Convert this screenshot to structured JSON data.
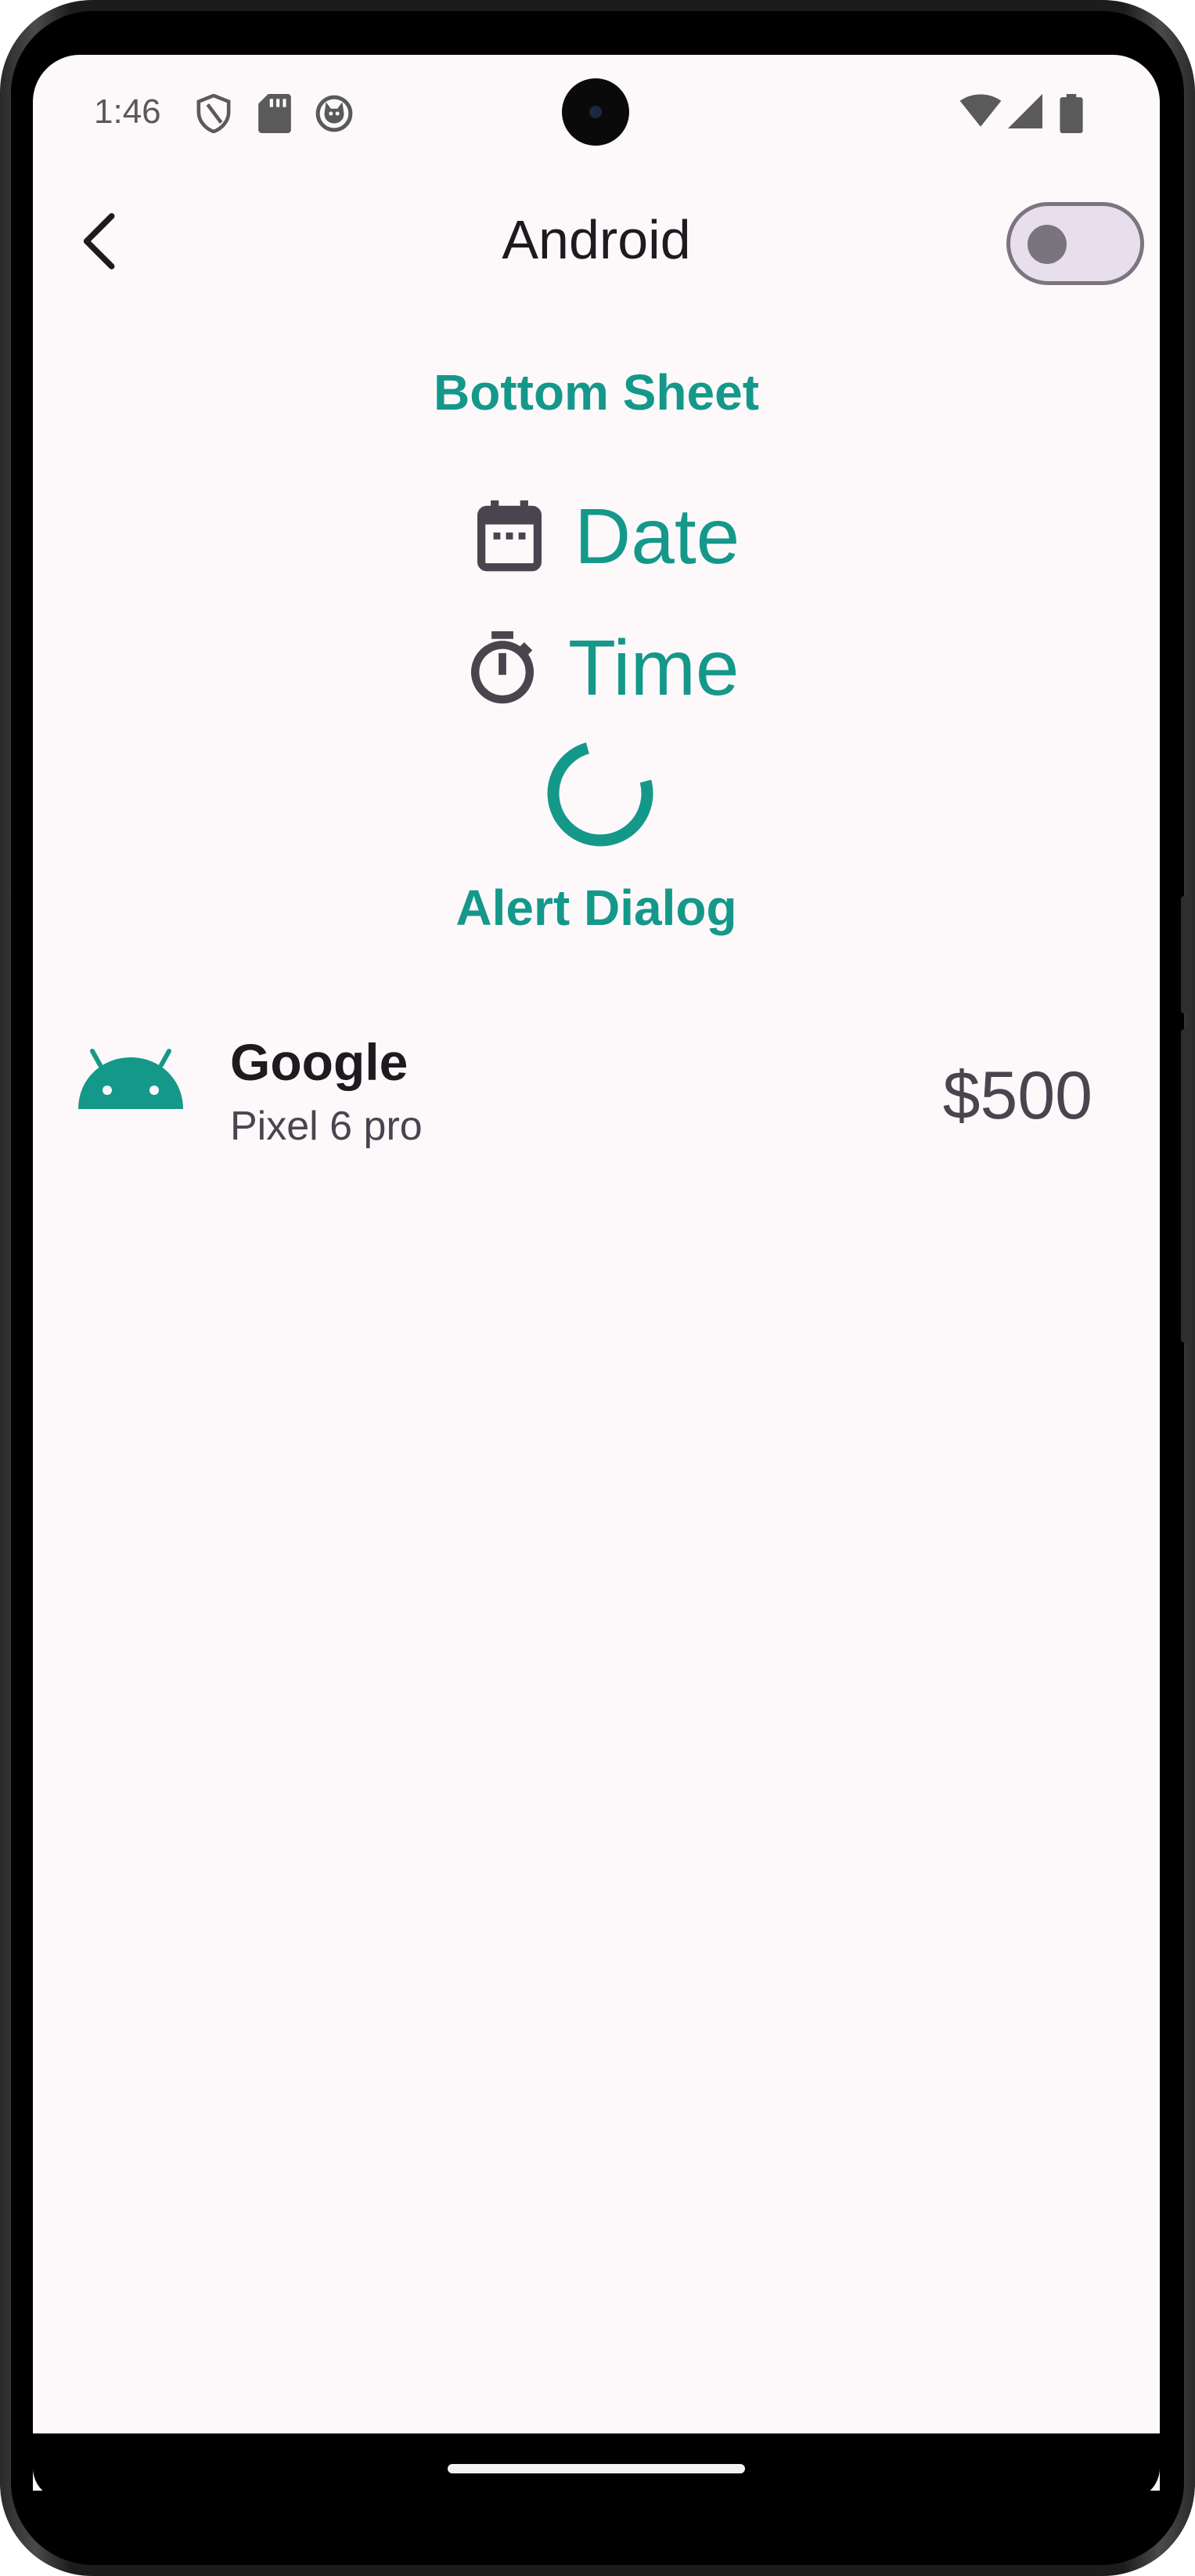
{
  "status_bar": {
    "time": "1:46",
    "left_icons": [
      "shield-icon",
      "sd-card-icon",
      "cat-icon"
    ],
    "right_icons": [
      "wifi-icon",
      "signal-icon",
      "battery-icon"
    ]
  },
  "app_bar": {
    "title": "Android",
    "back_icon": "arrow-back-icon",
    "switch_state": "off"
  },
  "content": {
    "bottom_sheet_label": "Bottom Sheet",
    "date_label": "Date",
    "date_icon": "calendar-icon",
    "time_label": "Time",
    "time_icon": "timer-icon",
    "alert_dialog_label": "Alert Dialog",
    "progress_indicator": "spinner"
  },
  "list_item": {
    "icon": "android-icon",
    "title": "Google",
    "subtitle": "Pixel 6 pro",
    "price": "$500"
  },
  "colors": {
    "accent": "#14988a",
    "background": "#fdf9fb",
    "text_primary": "#1d1b1f",
    "text_secondary": "#49454f"
  }
}
